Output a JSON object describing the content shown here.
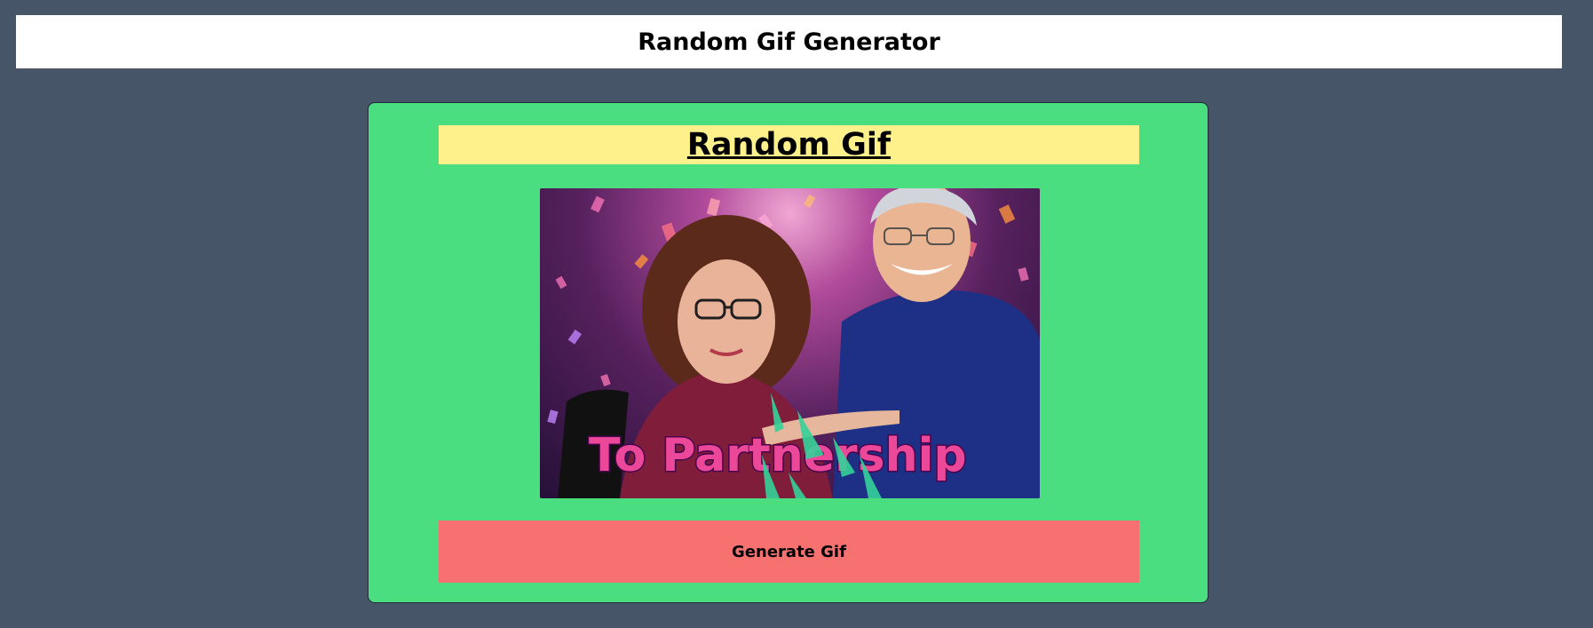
{
  "header": {
    "title": "Random Gif Generator"
  },
  "card": {
    "title": "Random Gif",
    "gif": {
      "caption": "To Partnership"
    },
    "generate_label": "Generate Gif"
  },
  "colors": {
    "background": "#475569",
    "header_bg": "#ffffff",
    "card_bg": "#4ade80",
    "title_bg": "#fef08a",
    "button_bg": "#f87171"
  }
}
